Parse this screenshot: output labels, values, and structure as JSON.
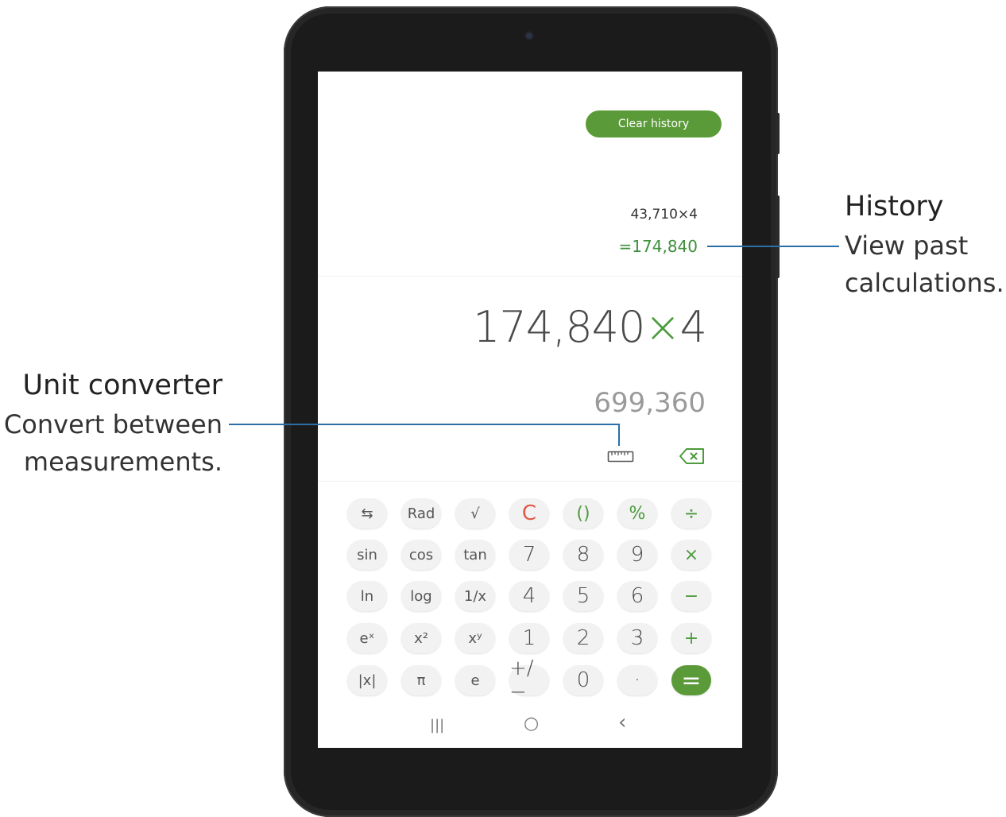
{
  "history": {
    "clear_label": "Clear history",
    "expression": "43,710×4",
    "result": "=174,840"
  },
  "display": {
    "expression_number": "174,840",
    "expression_operator": "×",
    "expression_operand": "4",
    "preview": "699,360"
  },
  "icons": {
    "unit_converter": "ruler-icon",
    "backspace": "backspace-icon"
  },
  "keypad": {
    "rows": [
      [
        "⇆",
        "Rad",
        "√",
        "C",
        "()",
        "%",
        "÷"
      ],
      [
        "sin",
        "cos",
        "tan",
        "7",
        "8",
        "9",
        "×"
      ],
      [
        "ln",
        "log",
        "1/x",
        "4",
        "5",
        "6",
        "−"
      ],
      [
        "eˣ",
        "x²",
        "xʸ",
        "1",
        "2",
        "3",
        "+"
      ],
      [
        "|x|",
        "π",
        "e",
        "+/−",
        "0",
        "·",
        "="
      ]
    ]
  },
  "navbar": {
    "recents": "|||",
    "home": "○",
    "back": "‹"
  },
  "callouts": {
    "history_title": "History",
    "history_text_1": "View past",
    "history_text_2": "calculations.",
    "unit_title": "Unit converter",
    "unit_text_1": "Convert between",
    "unit_text_2": "measurements."
  },
  "colors": {
    "accent_green": "#5b9a39",
    "operator_green": "#4c9b3c",
    "clear_red": "#e05a47",
    "callout_line": "#2a6fa8"
  }
}
